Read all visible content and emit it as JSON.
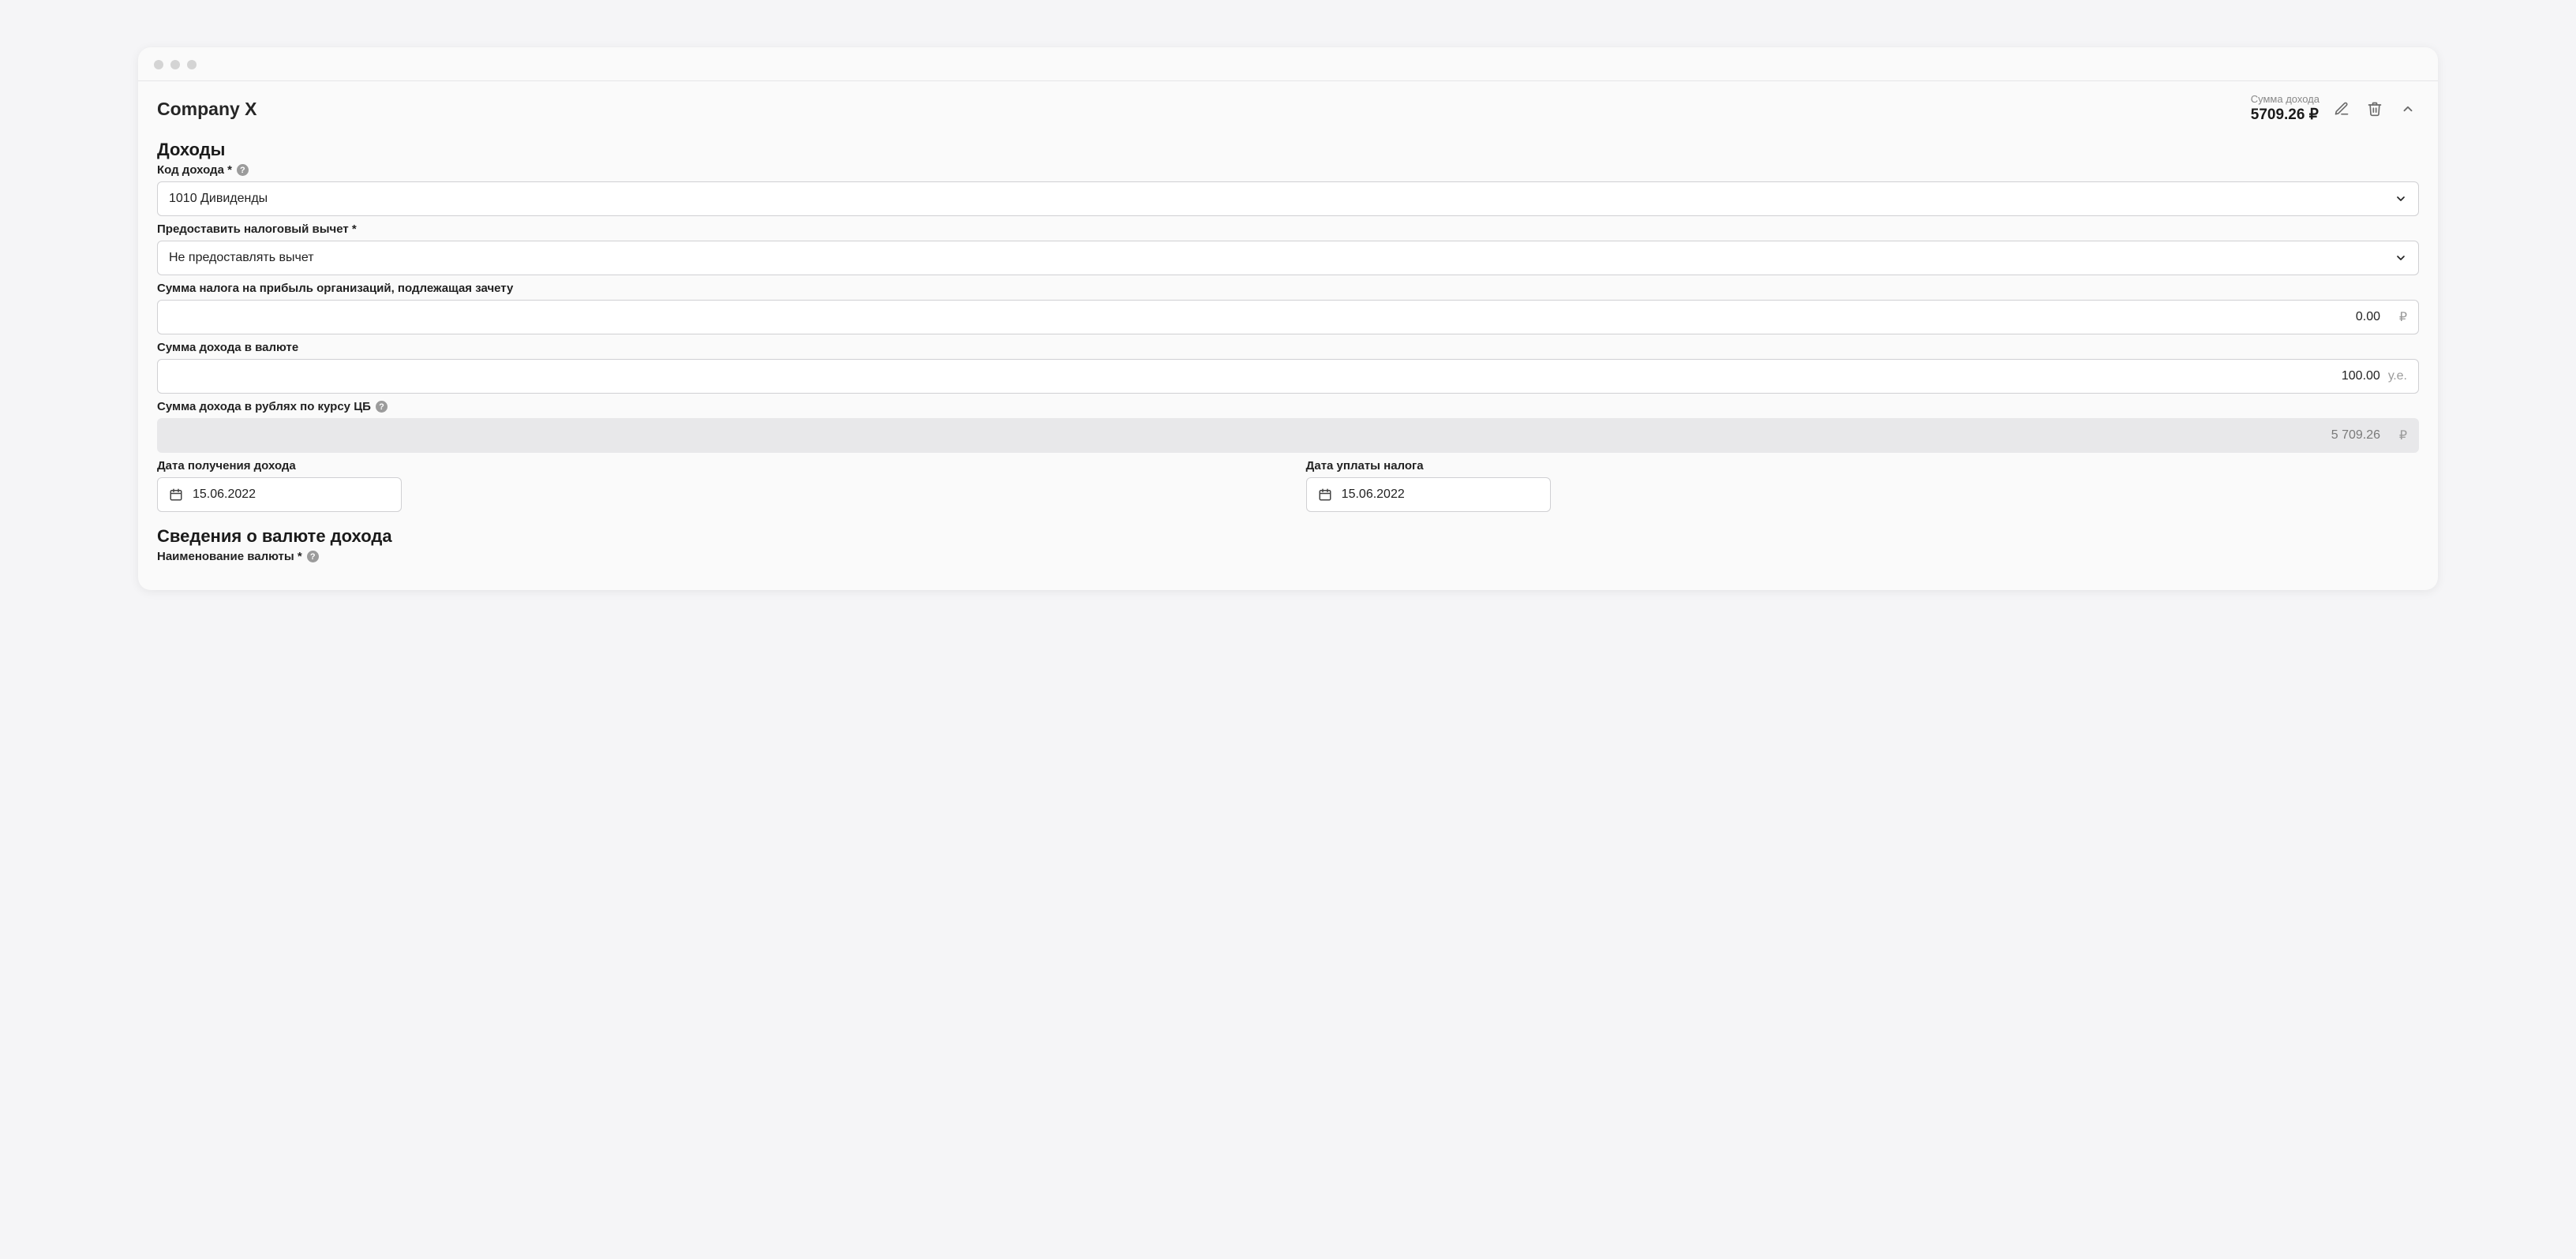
{
  "header": {
    "company_name": "Company X",
    "summary_label": "Сумма дохода",
    "summary_value": "5709.26 ₽"
  },
  "sections": {
    "income": {
      "title": "Доходы",
      "income_code_label": "Код дохода *",
      "income_code_value": "1010 Дивиденды",
      "tax_deduction_label": "Предоставить налоговый вычет *",
      "tax_deduction_value": "Не предоставлять вычет",
      "corp_tax_label": "Сумма налога на прибыль организаций, подлежащая зачету",
      "corp_tax_value": "0.00",
      "corp_tax_suffix": "₽",
      "fx_amount_label": "Сумма дохода в валюте",
      "fx_amount_value": "100.00",
      "fx_amount_suffix": "у.е.",
      "rub_amount_label": "Сумма дохода в рублях по курсу ЦБ",
      "rub_amount_value": "5 709.26",
      "rub_amount_suffix": "₽",
      "income_date_label": "Дата получения дохода",
      "income_date_value": "15.06.2022",
      "tax_date_label": "Дата уплаты налога",
      "tax_date_value": "15.06.2022"
    },
    "currency": {
      "title": "Сведения о валюте дохода",
      "currency_name_label": "Наименование валюты  *"
    }
  }
}
